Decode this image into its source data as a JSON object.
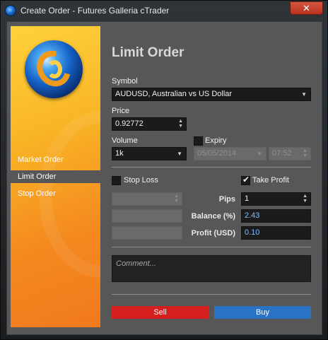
{
  "window": {
    "title": "Create Order - Futures Galleria cTrader",
    "close_label": "✕"
  },
  "sidebar": {
    "items": [
      {
        "label": "Market Order",
        "active": false
      },
      {
        "label": "Limit Order",
        "active": true
      },
      {
        "label": "Stop Order",
        "active": false
      }
    ]
  },
  "form": {
    "heading": "Limit Order",
    "symbol_label": "Symbol",
    "symbol_value": "AUDUSD, Australian vs US Dollar",
    "price_label": "Price",
    "price_value": "0.92772",
    "volume_label": "Volume",
    "volume_value": "1k",
    "expiry_label": "Expiry",
    "expiry_checked": false,
    "expiry_date": "05/05/2014",
    "expiry_time": "07:52",
    "stop_loss_label": "Stop Loss",
    "stop_loss_checked": false,
    "take_profit_label": "Take Profit",
    "take_profit_checked": true,
    "pips_label": "Pips",
    "pips_value": "1",
    "balance_label": "Balance (%)",
    "balance_value": "2.43",
    "profit_label": "Profit (USD)",
    "profit_value": "0.10",
    "comment_placeholder": "Comment...",
    "sell_label": "Sell",
    "buy_label": "Buy"
  },
  "colors": {
    "sell": "#d51f1f",
    "buy": "#2a73c4",
    "accent_sidebar": "#f9b526"
  }
}
